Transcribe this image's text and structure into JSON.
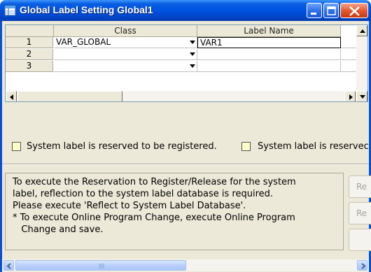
{
  "window": {
    "title": "Global Label Setting Global1",
    "icon": "table-icon"
  },
  "grid": {
    "columns": [
      "Class",
      "Label Name"
    ],
    "rows": [
      {
        "num": "1",
        "class": "VAR_GLOBAL",
        "label_name": "VAR1"
      },
      {
        "num": "2",
        "class": "",
        "label_name": ""
      },
      {
        "num": "3",
        "class": "",
        "label_name": ""
      }
    ]
  },
  "legend": {
    "reserved_register": "System label is reserved to be registered.",
    "reserved_release": "System label is reservec"
  },
  "info": {
    "text": "To execute the Reservation to Register/Release for the system\nlabel, reflection to the system label database is required.\nPlease execute 'Reflect to System Label Database'.\n* To execute Online Program Change, execute Online Program\n   Change and save."
  },
  "side_buttons": {
    "btn1": "Re",
    "btn2": "Re",
    "btn3": ""
  },
  "colors": {
    "title_bar": "#0054e3",
    "reserved_swatch": "#ffffc8"
  }
}
